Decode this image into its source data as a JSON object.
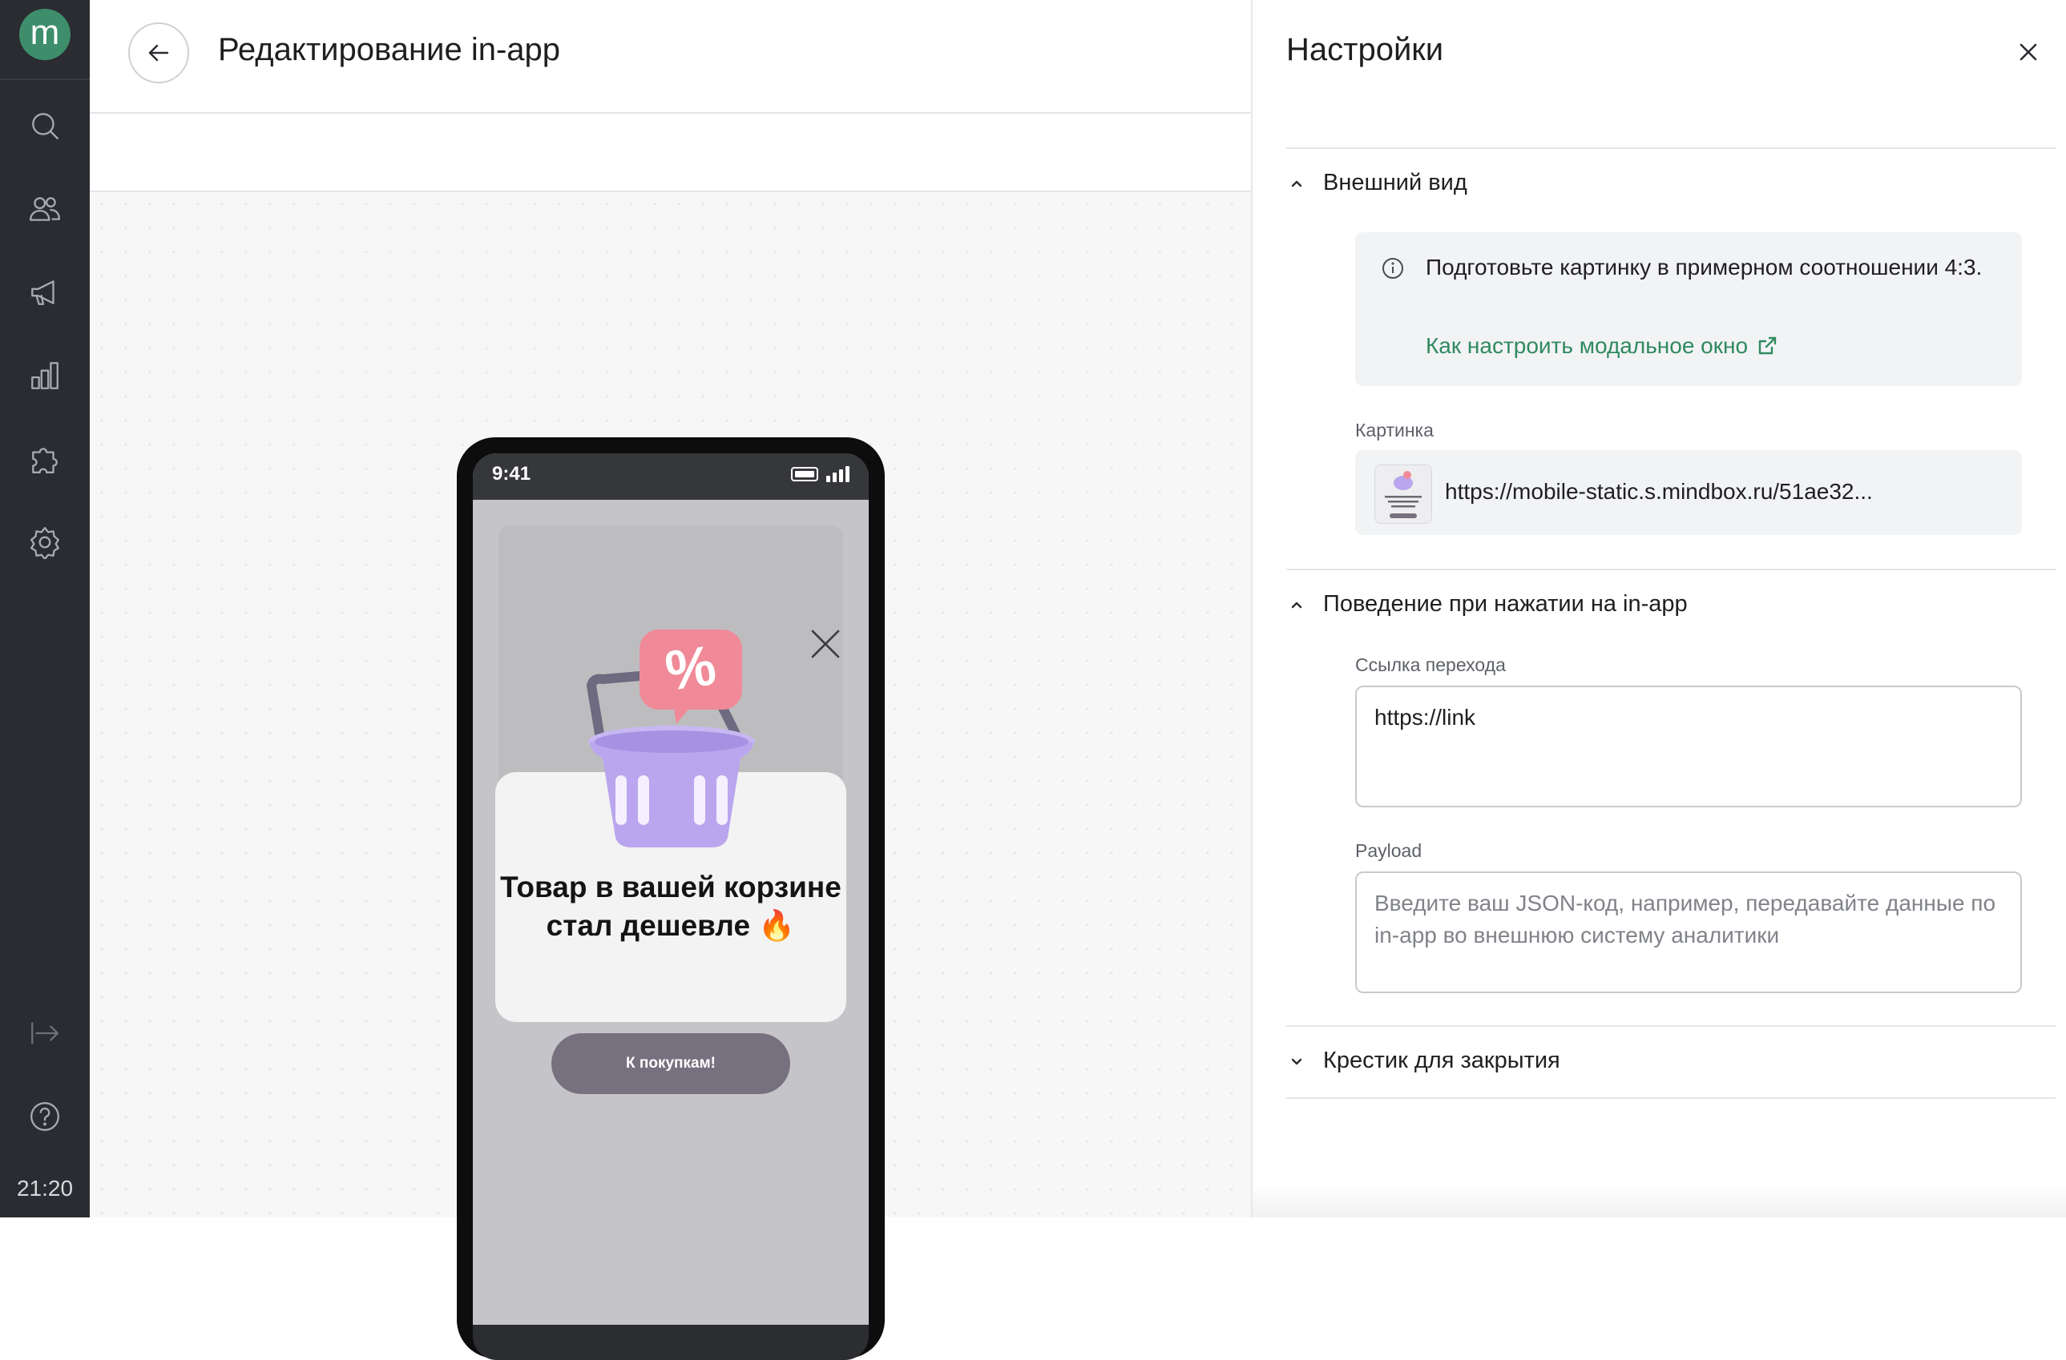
{
  "rail": {
    "logo_letter": "m",
    "icons": [
      "search-icon",
      "users-icon",
      "megaphone-icon",
      "bar-chart-icon",
      "puzzle-icon",
      "gear-icon",
      "collapse-arrow-icon",
      "help-icon"
    ],
    "time": "21:20"
  },
  "header": {
    "title": "Редактирование in-app"
  },
  "preview": {
    "status_time": "9:41",
    "headline": "Товар в вашей корзине стал дешевле 🔥",
    "button_label": "К покупкам!",
    "badge_symbol": "%",
    "colors": {
      "basket": "#b9a6ee",
      "badge": "#f08a98",
      "button": "#77707f"
    }
  },
  "panel": {
    "title": "Настройки",
    "appearance": {
      "label": "Внешний вид",
      "info_text": "Подготовьте картинку в примерном соотношении 4:3.",
      "info_link": "Как настроить модальное окно",
      "image_label": "Картинка",
      "image_url": "https://mobile-static.s.mindbox.ru/51ae32..."
    },
    "behavior": {
      "label": "Поведение при нажатии на in-app",
      "link_label": "Ссылка перехода",
      "link_value": "https://link",
      "payload_label": "Payload",
      "payload_placeholder": "Введите ваш JSON-код, например, передавайте данные по in-app во внешнюю систему аналитики"
    },
    "close_cross": {
      "label": "Крестик для закрытия"
    }
  },
  "colors": {
    "accent_green": "#2f8a5f",
    "rail_bg": "#2a2c31",
    "logo_bg": "#3e8e6b"
  }
}
